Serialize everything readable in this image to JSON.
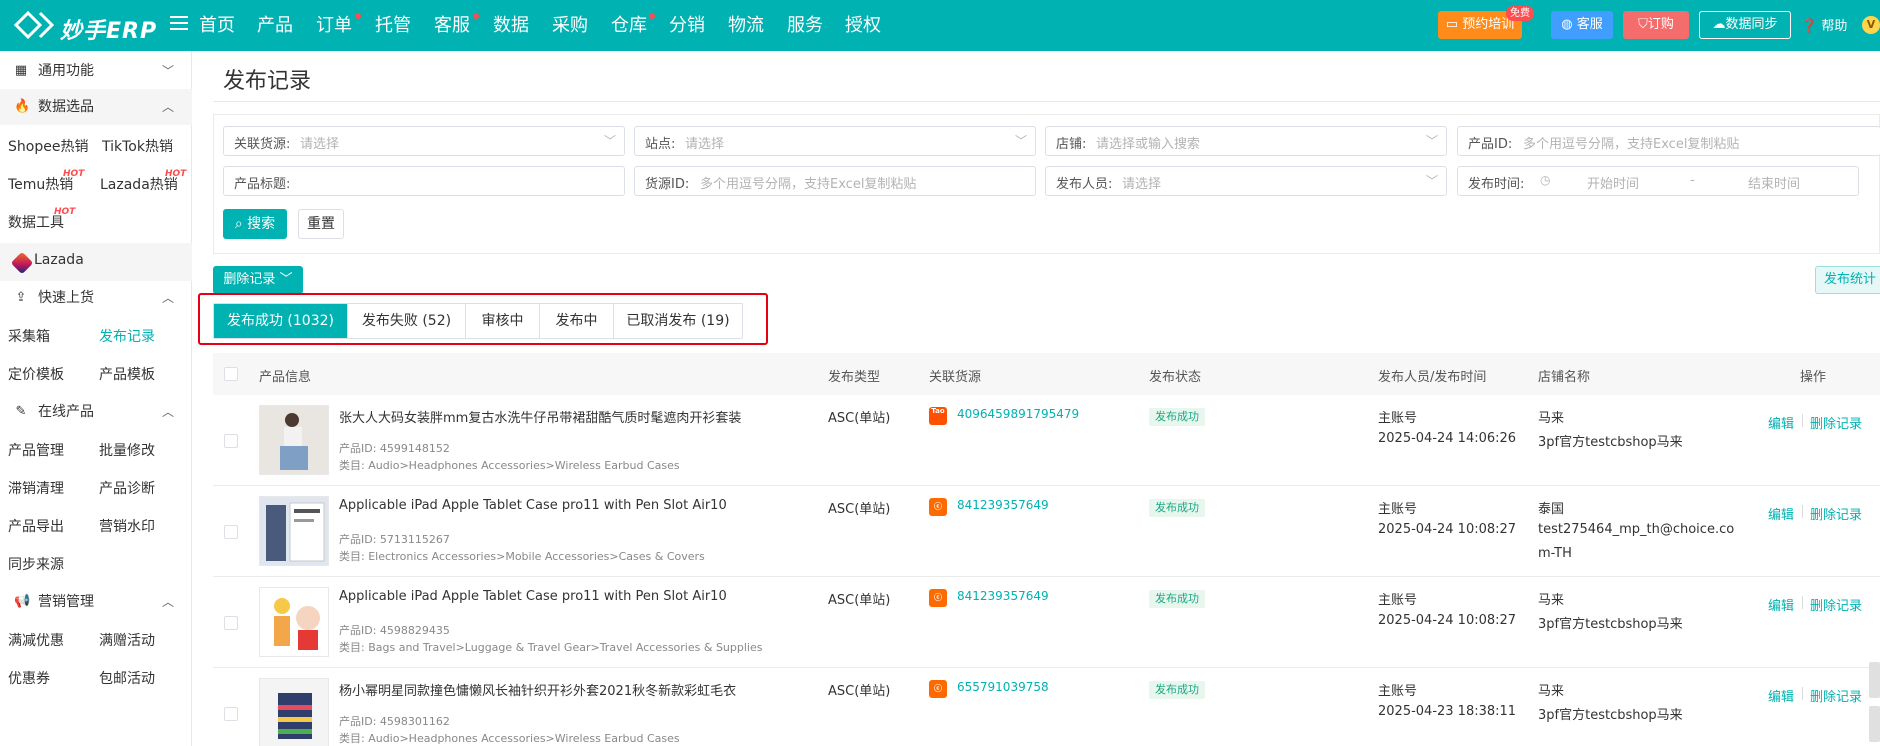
{
  "brand": {
    "name": "妙手ERP"
  },
  "nav": {
    "items": [
      {
        "label": "首页",
        "dot": false
      },
      {
        "label": "产品",
        "dot": false
      },
      {
        "label": "订单",
        "dot": true
      },
      {
        "label": "托管",
        "dot": false
      },
      {
        "label": "客服",
        "dot": true
      },
      {
        "label": "数据",
        "dot": false
      },
      {
        "label": "采购",
        "dot": false
      },
      {
        "label": "仓库",
        "dot": true
      },
      {
        "label": "分销",
        "dot": false
      },
      {
        "label": "物流",
        "dot": false
      },
      {
        "label": "服务",
        "dot": false
      },
      {
        "label": "授权",
        "dot": false
      }
    ]
  },
  "top_right": {
    "training": "预约培训",
    "free_tag": "免费",
    "kefu": "客服",
    "order": "订购",
    "sync": "数据同步",
    "help": "帮助",
    "vip": "V"
  },
  "sidebar": {
    "common": "通用功能",
    "data_select": "数据选品",
    "shopee_hot": "Shopee热销",
    "tiktok_hot": "TikTok热销",
    "temu_hot": "Temu热销",
    "lazada_hot": "Lazada热销",
    "data_tools": "数据工具",
    "hot_tag": "HOT",
    "lazada": "Lazada",
    "quick_upload": "快速上货",
    "collect_box": "采集箱",
    "publish_record": "发布记录",
    "price_template": "定价模板",
    "product_template": "产品模板",
    "online_products": "在线产品",
    "product_manage": "产品管理",
    "batch_edit": "批量修改",
    "slow_clear": "滞销清理",
    "product_diag": "产品诊断",
    "product_export": "产品导出",
    "watermark": "营销水印",
    "sync_source": "同步来源",
    "marketing": "营销管理",
    "discount": "满减优惠",
    "gift": "满赠活动",
    "coupon": "优惠券",
    "free_ship": "包邮活动"
  },
  "page": {
    "title": "发布记录"
  },
  "filters": {
    "source": {
      "label": "关联货源:",
      "placeholder": "请选择"
    },
    "site": {
      "label": "站点:",
      "placeholder": "请选择"
    },
    "shop": {
      "label": "店铺:",
      "placeholder": "请选择或输入搜索"
    },
    "product_id": {
      "label": "产品ID:",
      "placeholder": "多个用逗号分隔，支持Excel复制粘贴"
    },
    "product_title": {
      "label": "产品标题:",
      "placeholder": ""
    },
    "source_id": {
      "label": "货源ID:",
      "placeholder": "多个用逗号分隔，支持Excel复制粘贴"
    },
    "publisher": {
      "label": "发布人员:",
      "placeholder": "请选择"
    },
    "publish_time": {
      "label": "发布时间:",
      "start": "开始时间",
      "sep": "-",
      "end": "结束时间"
    },
    "search_btn": "搜索",
    "reset_btn": "重置"
  },
  "actions": {
    "delete_records": "删除记录",
    "publish_stats": "发布统计"
  },
  "tabs": [
    {
      "label": "发布成功 (1032)",
      "active": true
    },
    {
      "label": "发布失败 (52)",
      "active": false
    },
    {
      "label": "审核中",
      "active": false
    },
    {
      "label": "发布中",
      "active": false
    },
    {
      "label": "已取消发布 (19)",
      "active": false
    }
  ],
  "table": {
    "headers": {
      "product_info": "产品信息",
      "publish_type": "发布类型",
      "linked_source": "关联货源",
      "publish_status": "发布状态",
      "publisher_time": "发布人员/发布时间",
      "shop_name": "店铺名称",
      "operation": "操作"
    },
    "rows": [
      {
        "title": "张大人大码女装胖mm复古水洗牛仔吊带裙甜酷气质时髦遮肉开衫套装",
        "product_id": "产品ID: 4599148152",
        "category": "类目: Audio>Headphones Accessories>Wireless Earbud Cases",
        "type": "ASC(单站)",
        "source_icon": "Tao",
        "source_id": "4096459891795479",
        "status": "发布成功",
        "user": "主账号",
        "time": "2025-04-24 14:06:26",
        "shop_line1": "马来",
        "shop_line2": "3pf官方testcbshop马来",
        "shop_line3": "",
        "edit": "编辑",
        "delete": "删除记录"
      },
      {
        "title": "Applicable iPad Apple Tablet  Case pro11 with Pen Slot Air10",
        "product_id": "产品ID: 5713115267",
        "category": "类目: Electronics Accessories>Mobile Accessories>Cases & Covers",
        "type": "ASC(单站)",
        "source_icon": "1688",
        "source_id": "841239357649",
        "status": "发布成功",
        "user": "主账号",
        "time": "2025-04-24 10:08:27",
        "shop_line1": "泰国",
        "shop_line2": "test275464_mp_th@choice.co",
        "shop_line3": "m-TH",
        "edit": "编辑",
        "delete": "删除记录"
      },
      {
        "title": "Applicable iPad Apple Tablet  Case pro11 with Pen Slot Air10",
        "product_id": "产品ID: 4598829435",
        "category": "类目: Bags and Travel>Luggage & Travel Gear>Travel Accessories & Supplies",
        "type": "ASC(单站)",
        "source_icon": "1688",
        "source_id": "841239357649",
        "status": "发布成功",
        "user": "主账号",
        "time": "2025-04-24 10:08:27",
        "shop_line1": "马来",
        "shop_line2": "3pf官方testcbshop马来",
        "shop_line3": "",
        "edit": "编辑",
        "delete": "删除记录"
      },
      {
        "title": "杨小幂明星同款撞色慵懒风长袖针织开衫外套2021秋冬新款彩虹毛衣",
        "product_id": "产品ID: 4598301162",
        "category": "类目: Audio>Headphones Accessories>Wireless Earbud Cases",
        "type": "ASC(单站)",
        "source_icon": "1688",
        "source_id": "655791039758",
        "status": "发布成功",
        "user": "主账号",
        "time": "2025-04-23 18:38:11",
        "shop_line1": "马来",
        "shop_line2": "3pf官方testcbshop马来",
        "shop_line3": "",
        "edit": "编辑",
        "delete": "删除记录"
      }
    ]
  },
  "icons": {
    "menu": "hamburger-icon",
    "search": "search-icon",
    "chevron": "chevron-down-icon",
    "clock": "clock-icon"
  },
  "colors": {
    "primary": "#00b2b1",
    "danger_outline": "#e60012",
    "success_tag": "#1ba784"
  }
}
